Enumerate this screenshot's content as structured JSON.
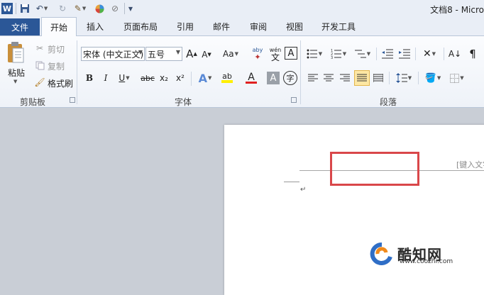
{
  "titlebar": {
    "title": "文档8 - Micro",
    "quick_access": {
      "undo_icon": "undo-icon",
      "redo_icon": "redo-icon",
      "save_icon": "save-icon"
    }
  },
  "tabs": [
    {
      "label": "文件"
    },
    {
      "label": "开始"
    },
    {
      "label": "插入"
    },
    {
      "label": "页面布局"
    },
    {
      "label": "引用"
    },
    {
      "label": "邮件"
    },
    {
      "label": "审阅"
    },
    {
      "label": "视图"
    },
    {
      "label": "开发工具"
    }
  ],
  "clipboard": {
    "paste": "粘贴",
    "cut": "剪切",
    "copy": "复制",
    "format_painter": "格式刷",
    "group": "剪贴板"
  },
  "font": {
    "family": "宋体 (中文正文)",
    "size": "五号",
    "grow": "A",
    "shrink": "A",
    "case": "Aa",
    "bold": "B",
    "italic": "I",
    "underline": "U",
    "strike": "abc",
    "sub": "x₂",
    "sup": "x²",
    "highlight": "ab",
    "color": "A",
    "shade": "A",
    "encircle": "字",
    "phonetic": "wén",
    "phonetic_char": "文",
    "group": "字体"
  },
  "paragraph": {
    "group": "段落"
  },
  "document": {
    "header_hint": "[键入文字]",
    "para_mark": "↵"
  },
  "watermark": {
    "name": "酷知网",
    "url": "www.coozhi.com"
  },
  "colors": {
    "file_tab": "#2b5797",
    "highlight_box": "#d9474a",
    "font_color": "#e02020",
    "highlight_color": "#ffef00"
  }
}
